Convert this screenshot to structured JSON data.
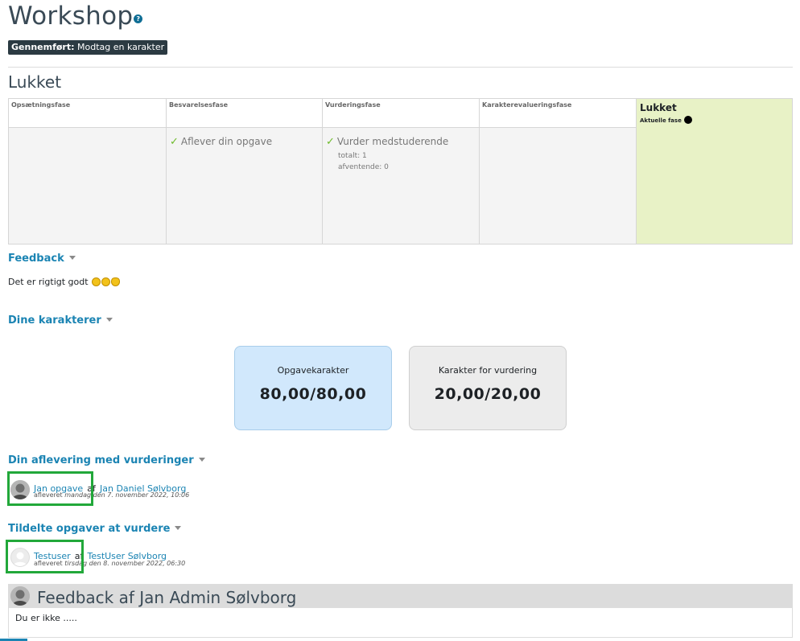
{
  "page": {
    "title": "Workshop",
    "help_icon": "question-icon",
    "badge_label": "Gennemført:",
    "badge_text": "Modtag en karakter"
  },
  "phase_section_title": "Lukket",
  "phases": [
    {
      "name": "Opsætningsfase"
    },
    {
      "name": "Besvarelsesfase",
      "task": "Aflever din opgave"
    },
    {
      "name": "Vurderingsfase",
      "task": "Vurder medstuderende",
      "details": [
        "totalt: 1",
        "afventende: 0"
      ]
    },
    {
      "name": "Karakterevalueringsfase"
    },
    {
      "name": "Lukket",
      "current_label": "Aktuelle fase"
    }
  ],
  "feedback": {
    "heading": "Feedback",
    "text": "Det er rigtigt godt"
  },
  "grades": {
    "heading": "Dine karakterer",
    "cards": [
      {
        "label": "Opgavekarakter",
        "value": "80,00/80,00"
      },
      {
        "label": "Karakter for vurdering",
        "value": "20,00/20,00"
      }
    ]
  },
  "submission": {
    "heading": "Din aflevering med vurderinger",
    "title": "Jan opgave",
    "by": "af",
    "author": "Jan Daniel Sølvborg",
    "meta_prefix": "afleveret",
    "meta_day": "mandag",
    "meta_date": "den 7. november 2022, 10:06"
  },
  "assigned": {
    "heading": "Tildelte opgaver at vurdere",
    "title": "Testuser",
    "by": "af",
    "author": "TestUser Sølvborg",
    "meta_prefix": "afleveret",
    "meta_day": "tirsdag",
    "meta_date": "den 8. november 2022, 06:30"
  },
  "feedback_by": {
    "title": "Feedback af Jan Admin Sølvborg",
    "text": "Du er ikke ....."
  },
  "colors": {
    "link": "#1b84b3",
    "active_phase": "#e8f2c6",
    "grade_card": "#d1e8fc",
    "highlight": "#22a83a"
  }
}
